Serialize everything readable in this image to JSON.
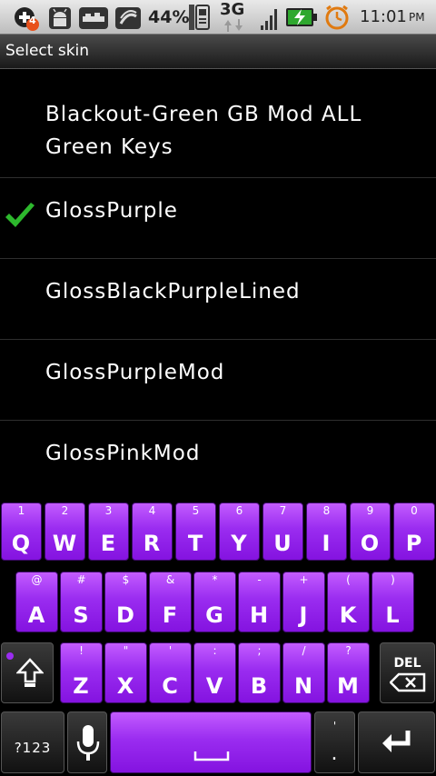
{
  "status_bar": {
    "notification_badge": "4",
    "battery_percent": "44%",
    "network_type": "3G",
    "time": "11:01",
    "ampm": "PM"
  },
  "title_bar": {
    "title": "Select skin"
  },
  "skins": {
    "item0": {
      "label_line1": "Blackout-Green GB Mod ALL",
      "label_line2": "Green Keys",
      "selected": false
    },
    "item1": {
      "label": "GlossPurple",
      "selected": true
    },
    "item2": {
      "label": "GlossBlackPurpleLined",
      "selected": false
    },
    "item3": {
      "label": "GlossPurpleMod",
      "selected": false
    },
    "item4": {
      "label": "GlossPinkMod",
      "selected": false
    }
  },
  "keyboard": {
    "row1": [
      {
        "top": "1",
        "main": "Q"
      },
      {
        "top": "2",
        "main": "W"
      },
      {
        "top": "3",
        "main": "E"
      },
      {
        "top": "4",
        "main": "R"
      },
      {
        "top": "5",
        "main": "T"
      },
      {
        "top": "6",
        "main": "Y"
      },
      {
        "top": "7",
        "main": "U"
      },
      {
        "top": "8",
        "main": "I"
      },
      {
        "top": "9",
        "main": "O"
      },
      {
        "top": "0",
        "main": "P"
      }
    ],
    "row2": [
      {
        "top": "@",
        "main": "A"
      },
      {
        "top": "#",
        "main": "S"
      },
      {
        "top": "$",
        "main": "D"
      },
      {
        "top": "&",
        "main": "F"
      },
      {
        "top": "*",
        "main": "G"
      },
      {
        "top": "-",
        "main": "H"
      },
      {
        "top": "+",
        "main": "J"
      },
      {
        "top": "(",
        "main": "K"
      },
      {
        "top": ")",
        "main": "L"
      }
    ],
    "row3": [
      {
        "top": "!",
        "main": "Z"
      },
      {
        "top": "\"",
        "main": "X"
      },
      {
        "top": "'",
        "main": "C"
      },
      {
        "top": ":",
        "main": "V"
      },
      {
        "top": ";",
        "main": "B"
      },
      {
        "top": "/",
        "main": "N"
      },
      {
        "top": "?",
        "main": "M"
      }
    ],
    "del_label": "DEL",
    "symbols_label": "?123",
    "period_top": "'",
    "period_main": "."
  },
  "colors": {
    "key_purple": "#9a2cf0",
    "check_green": "#2db82d",
    "list_bg": "#000000"
  },
  "icons": [
    "add-notification-icon",
    "android-debug-icon",
    "usb-icon",
    "sync-icon",
    "sim-icon",
    "signal-icon",
    "battery-charging-icon",
    "alarm-icon",
    "checkmark-icon",
    "shift-icon",
    "delete-icon",
    "microphone-icon",
    "enter-icon"
  ]
}
